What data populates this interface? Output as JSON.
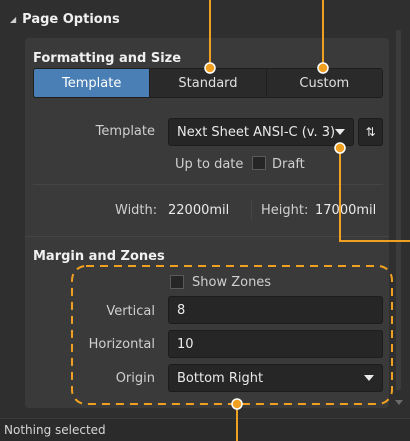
{
  "section": {
    "title": "Page Options"
  },
  "formatting": {
    "title": "Formatting and Size",
    "tabs": [
      {
        "label": "Template",
        "active": true
      },
      {
        "label": "Standard",
        "active": false
      },
      {
        "label": "Custom",
        "active": false
      }
    ],
    "template_label": "Template",
    "template_value": "Next Sheet ANSI-C (v. 3)",
    "status_text": "Up to date",
    "draft_label": "Draft",
    "draft_checked": false,
    "width_label": "Width:",
    "width_value": "22000mil",
    "height_label": "Height:",
    "height_value": "17000mil"
  },
  "margins": {
    "title": "Margin and Zones",
    "show_zones_label": "Show Zones",
    "show_zones_checked": false,
    "vertical_label": "Vertical",
    "vertical_value": "8",
    "horizontal_label": "Horizontal",
    "horizontal_value": "10",
    "origin_label": "Origin",
    "origin_value": "Bottom Right"
  },
  "status_bar": {
    "text": "Nothing selected"
  },
  "colors": {
    "accent": "#4a7fb5",
    "annotation": "#f0a020",
    "background": "#2f2f2f"
  },
  "icons": {
    "collapse": "triangle-collapse-icon",
    "dropdown": "chevron-down-icon",
    "refresh": "sync-arrows-icon",
    "scroll_down": "scroll-down-arrow-icon"
  }
}
